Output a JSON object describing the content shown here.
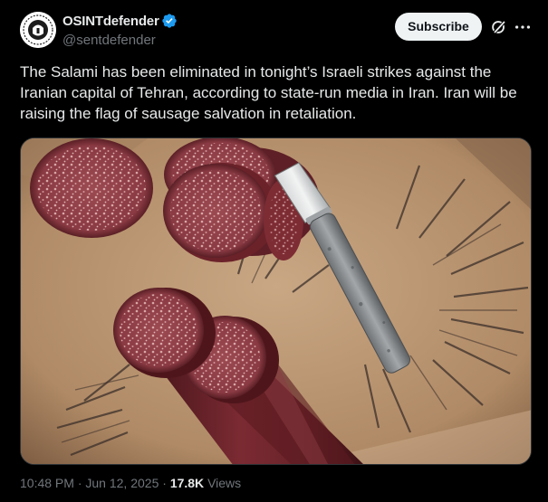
{
  "author": {
    "display_name": "OSINTdefender",
    "handle": "@sentdefender",
    "verified": true,
    "avatar_icon": "osintdefender-logo"
  },
  "actions": {
    "subscribe_label": "Subscribe",
    "grok_icon": "grok-icon",
    "more_icon": "more-icon"
  },
  "tweet": {
    "text": "The Salami has been eliminated in tonight’s Israeli strikes against the Iranian capital of Tehran, according to state-run media in Iran. Iran will be raising the flag of sausage salvation in retaliation."
  },
  "media": {
    "description_icon": "salami-photo",
    "colors": {
      "paper": "#b99672",
      "salami": "#7a2a30",
      "fat": "#d9a9a8",
      "knife": "#8f9395"
    }
  },
  "meta": {
    "time": "10:48 PM",
    "separator": "·",
    "date": "Jun 12, 2025",
    "separator2": "·",
    "views_count": "17.8K",
    "views_label": "Views"
  },
  "colors": {
    "background": "#000000",
    "text": "#e7e9ea",
    "secondary": "#71767b",
    "verified": "#1d9bf0"
  }
}
